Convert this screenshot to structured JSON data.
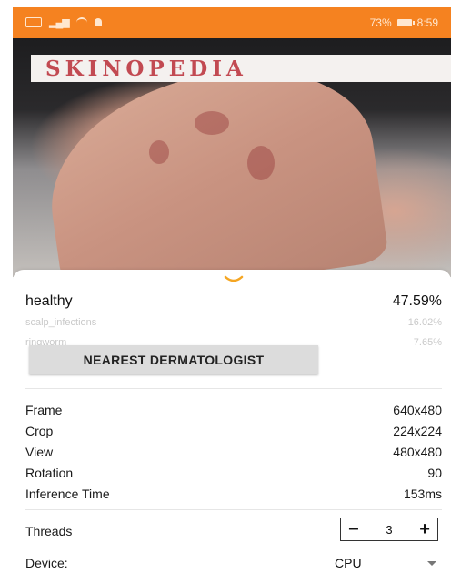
{
  "status_bar": {
    "battery": "73%",
    "time": "8:59"
  },
  "app": {
    "title": "SKINOPEDIA"
  },
  "results": [
    {
      "label": "healthy",
      "value": "47.59%"
    },
    {
      "label": "scalp_infections",
      "value": "16.02%"
    },
    {
      "label": "ringworm",
      "value": "7.65%"
    }
  ],
  "actions": {
    "nearest_dermatologist": "NEAREST DERMATOLOGIST"
  },
  "info": [
    {
      "label": "Frame",
      "value": "640x480"
    },
    {
      "label": "Crop",
      "value": "224x224"
    },
    {
      "label": "View",
      "value": "480x480"
    },
    {
      "label": "Rotation",
      "value": "90"
    },
    {
      "label": "Inference Time",
      "value": "153ms"
    }
  ],
  "threads": {
    "label": "Threads",
    "value": "3",
    "minus": "−",
    "plus": "+"
  },
  "device": {
    "label": "Device:",
    "value": "CPU"
  },
  "colors": {
    "status_bar": "#f58220",
    "title": "#c24a52",
    "chevron": "#f5a623",
    "button": "#dcdcdc"
  }
}
